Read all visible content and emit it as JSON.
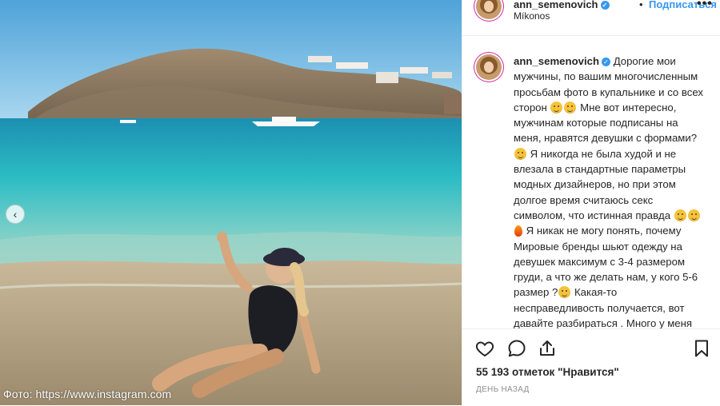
{
  "post": {
    "username": "ann_semenovich",
    "follow_label": "Подписаться",
    "location": "Míkonos",
    "dot": "•",
    "more_label": "•••",
    "caption": "Дорогие мои мужчины, по вашим многочисленным просьбам фото в купальнике и со всех сторон",
    "caption_2": "Мне вот интересно, мужчинам которые подписаны на меня, нравятся девушки с формами?",
    "caption_3": "Я никогда не была худой и не влезала в стандартные параметры модных дизайнеров, но при этом долгое время считаюсь секс символом, что истинная правда",
    "caption_4": "Я никак не могу понять, почему Мировые бренды шьют одежду на девушек максимум с 3-4 размером груди, а что же делать нам, у кого 5-6 размер ?",
    "caption_5": "Какая-то несправедливость получается, вот давайте разбираться . Много у меня подписчиц с пышной грудью?",
    "likes": "55 193 отметок \"Нравится\"",
    "time": "ДЕНЬ НАЗАД"
  },
  "photo": {
    "watermark": "Фото: https://www.instagram.com",
    "prev_label": "‹"
  },
  "icons": {
    "verified": "verified-badge-icon",
    "like": "heart-icon",
    "comment": "comment-icon",
    "share": "share-icon",
    "save": "bookmark-icon",
    "prev": "chevron-left-icon"
  },
  "colors": {
    "accent": "#3897f0",
    "text": "#262626",
    "muted": "#8e8e8e"
  }
}
